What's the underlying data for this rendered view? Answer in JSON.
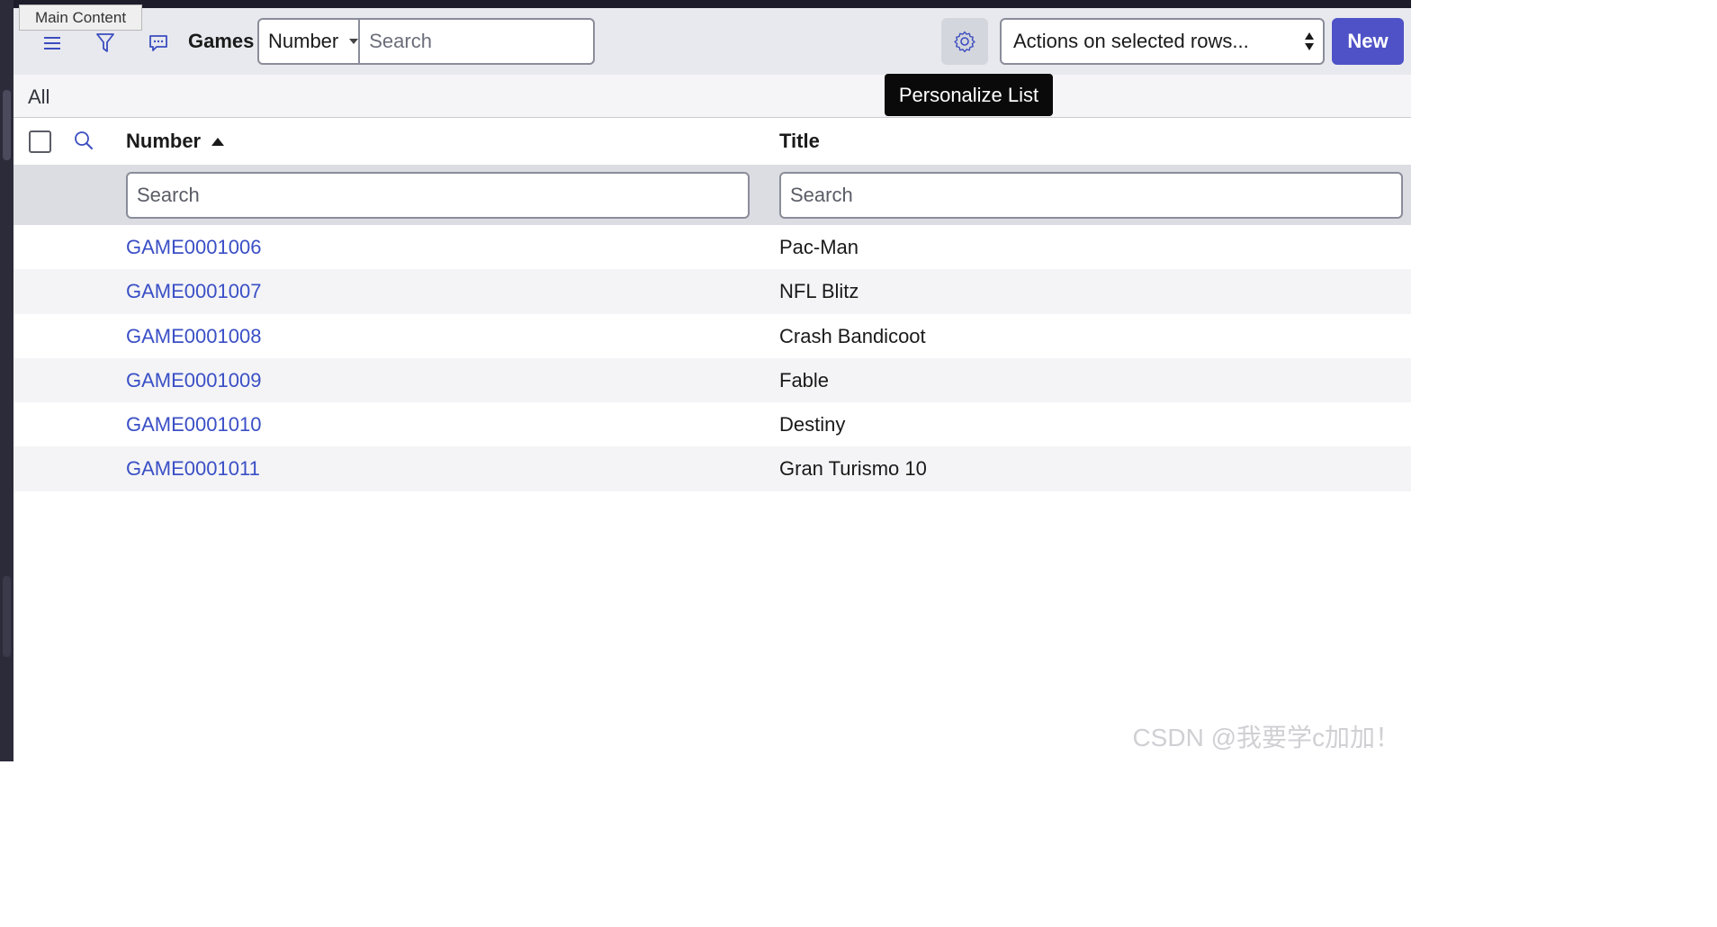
{
  "tooltip_main": "Main Content",
  "toolbar": {
    "title": "Games",
    "field_select": "Number",
    "search_placeholder": "Search",
    "actions_select": "Actions on selected rows...",
    "new_label": "New",
    "icons": [
      "hamburger-icon",
      "filter-icon",
      "chat-icon",
      "gear-icon"
    ]
  },
  "breadcrumb": "All",
  "gear_tooltip": "Personalize List",
  "columns": {
    "number": "Number",
    "title": "Title",
    "sort": "ascending"
  },
  "filters": {
    "number_placeholder": "Search",
    "title_placeholder": "Search"
  },
  "rows": [
    {
      "number": "GAME0001006",
      "title": "Pac-Man"
    },
    {
      "number": "GAME0001007",
      "title": "NFL Blitz"
    },
    {
      "number": "GAME0001008",
      "title": "Crash Bandicoot"
    },
    {
      "number": "GAME0001009",
      "title": "Fable"
    },
    {
      "number": "GAME0001010",
      "title": "Destiny"
    },
    {
      "number": "GAME0001011",
      "title": "Gran Turismo 10"
    }
  ],
  "watermark": "CSDN @我要学c加加！",
  "colors": {
    "accent": "#4f52c7",
    "link": "#3a4fc6",
    "toolbar_bg": "#e8e9ee"
  }
}
